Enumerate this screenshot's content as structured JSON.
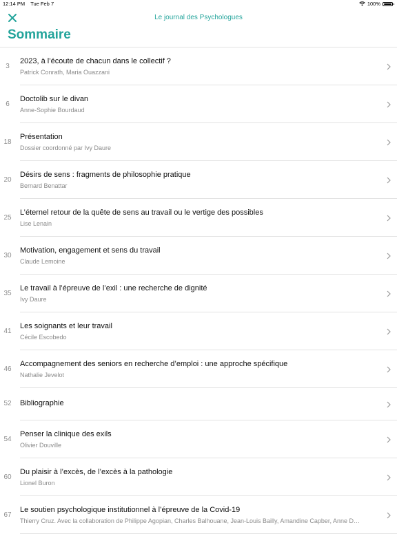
{
  "status_bar": {
    "time": "12:14 PM",
    "date": "Tue Feb 7",
    "battery": "100%"
  },
  "nav": {
    "title": "Le journal des Psychologues"
  },
  "page_title": "Sommaire",
  "accent_color": "#23a49b",
  "toc": [
    {
      "page": "3",
      "title": "2023, à l’écoute de chacun dans le collectif ?",
      "author": "Patrick Conrath, Maria Ouazzani"
    },
    {
      "page": "6",
      "title": "Doctolib sur le divan",
      "author": "Anne-Sophie Bourdaud"
    },
    {
      "page": "18",
      "title": "Présentation",
      "author": "Dossier coordonné par Ivy Daure"
    },
    {
      "page": "20",
      "title": "Désirs de sens : fragments de philosophie pratique",
      "author": "Bernard Benattar"
    },
    {
      "page": "25",
      "title": "L’éternel retour de la quête de sens au travail ou le vertige des possibles",
      "author": "Lise Lenain"
    },
    {
      "page": "30",
      "title": "Motivation, engagement et sens du travail",
      "author": "Claude Lemoine"
    },
    {
      "page": "35",
      "title": "Le travail à l’épreuve de l’exil : une recherche de dignité",
      "author": "Ivy Daure"
    },
    {
      "page": "41",
      "title": "Les soignants et leur travail",
      "author": "Cécile Escobedo"
    },
    {
      "page": "46",
      "title": "Accompagnement des seniors en recherche d’emploi : une approche spécifique",
      "author": "Nathalie Jevelot"
    },
    {
      "page": "52",
      "title": "Bibliographie",
      "author": ""
    },
    {
      "page": "54",
      "title": "Penser la clinique des exils",
      "author": "Olivier Douville"
    },
    {
      "page": "60",
      "title": "Du plaisir à l’excès, de l’excès à la pathologie",
      "author": "Lionel Buron"
    },
    {
      "page": "67",
      "title": "Le soutien psychologique institutionnel à l’épreuve de la Covid-19",
      "author": "Thierry Cruz. Avec la collaboration de Philippe Agopian, Charles Balhouane, Jean-Louis Bailly, Amandine Capber, Anne D…"
    }
  ]
}
